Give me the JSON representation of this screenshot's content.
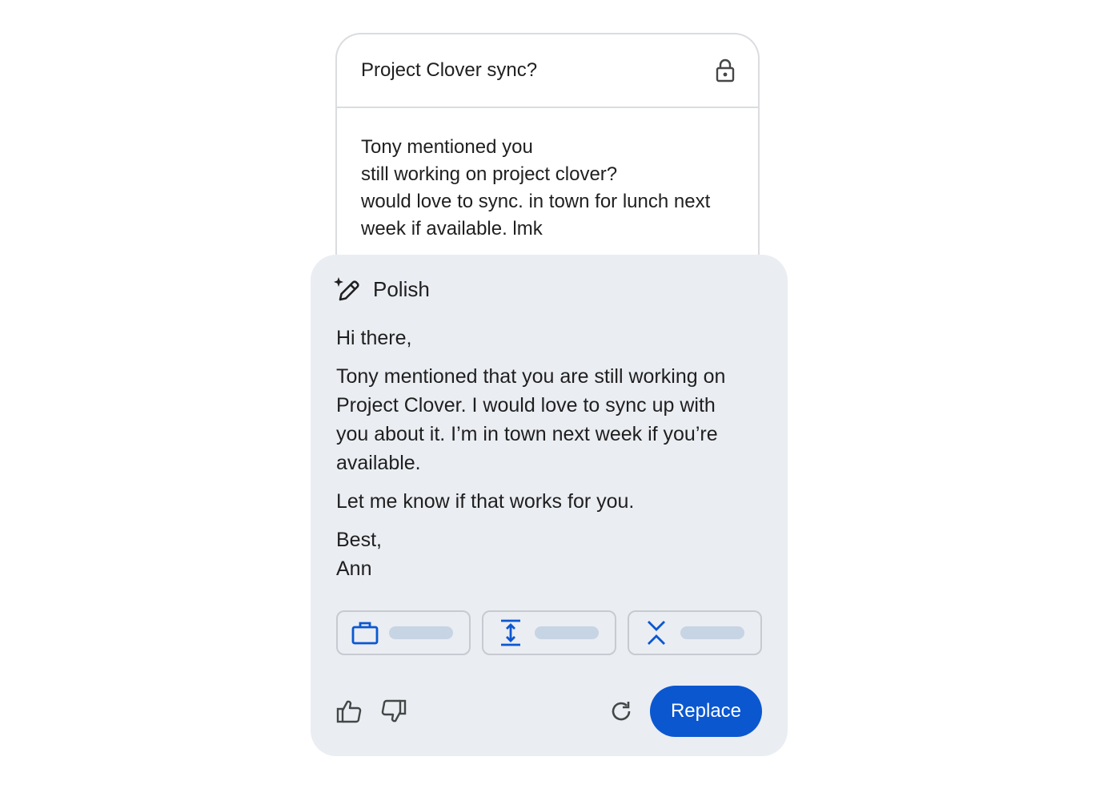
{
  "compose": {
    "subject": "Project Clover sync?",
    "lock_icon": "lock-icon",
    "draft_lines": [
      "Tony mentioned you",
      "still working on project clover?",
      "would love to sync. in town for lunch next",
      "week if available. lmk"
    ]
  },
  "polish": {
    "title": "Polish",
    "icon": "pen-sparkle-icon",
    "greeting": "Hi there,",
    "lines": [
      "Tony mentioned that you are still working on",
      "Project Clover. I would love to sync up with",
      "you about it. I’m in town next week if you’re",
      "available."
    ],
    "closing": "Let me know if that works for you.",
    "signoff": "Best,",
    "name": "Ann",
    "chips": [
      {
        "icon": "briefcase-icon"
      },
      {
        "icon": "elaborate-icon"
      },
      {
        "icon": "shorten-icon"
      }
    ],
    "footer": {
      "thumb_up_icon": "thumb-up-icon",
      "thumb_down_icon": "thumb-down-icon",
      "regenerate_icon": "refresh-icon",
      "replace_label": "Replace"
    }
  },
  "colors": {
    "accent": "#0b57d0",
    "panel_bg": "#eaedf2",
    "chip_placeholder": "#c6d4e4"
  }
}
